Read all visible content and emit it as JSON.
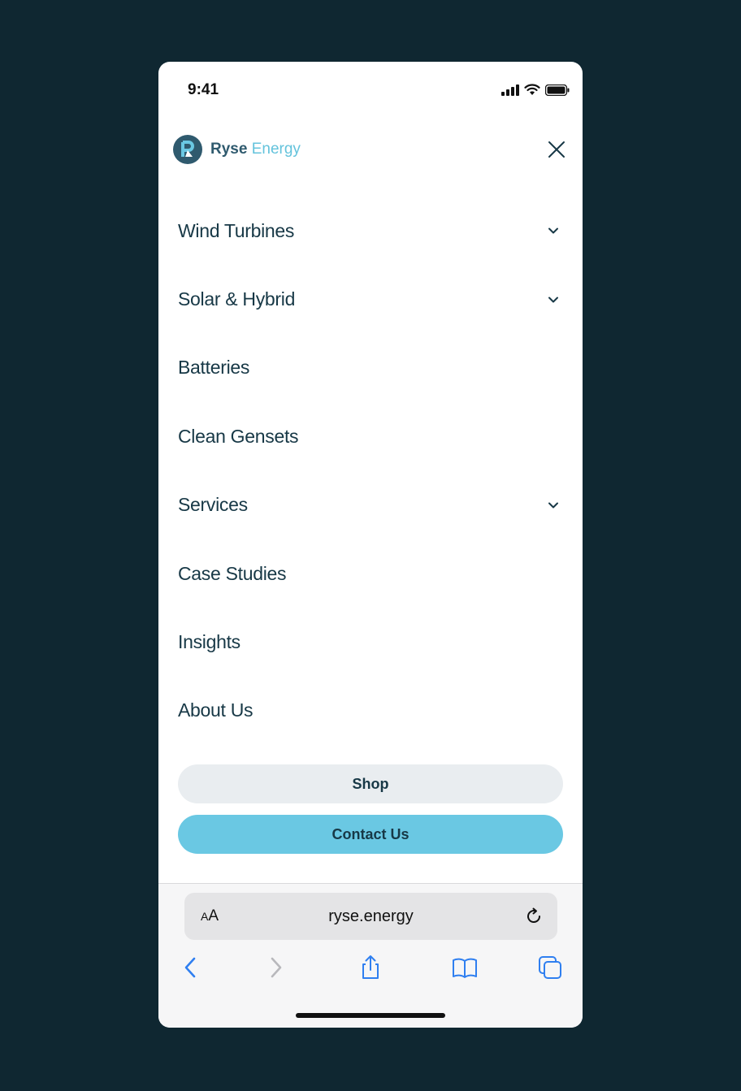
{
  "status_bar": {
    "time": "9:41"
  },
  "header": {
    "brand_part1": "Ryse",
    "brand_part2": "Energy"
  },
  "menu": {
    "items": [
      {
        "label": "Wind Turbines",
        "has_submenu": true
      },
      {
        "label": "Solar & Hybrid",
        "has_submenu": true
      },
      {
        "label": "Batteries",
        "has_submenu": false
      },
      {
        "label": "Clean Gensets",
        "has_submenu": false
      },
      {
        "label": "Services",
        "has_submenu": true
      },
      {
        "label": "Case Studies",
        "has_submenu": false
      },
      {
        "label": "Insights",
        "has_submenu": false
      },
      {
        "label": "About Us",
        "has_submenu": false
      }
    ]
  },
  "actions": {
    "shop_label": "Shop",
    "contact_label": "Contact Us"
  },
  "browser": {
    "aa_small": "A",
    "aa_large": "A",
    "url": "ryse.energy"
  },
  "colors": {
    "background": "#0f2731",
    "brand_dark": "#2f5a6e",
    "brand_light": "#64c3dc",
    "contact_button": "#6ac8e3",
    "shop_button": "#e9edf0",
    "text": "#173846",
    "ios_blue": "#2f7ff0"
  }
}
